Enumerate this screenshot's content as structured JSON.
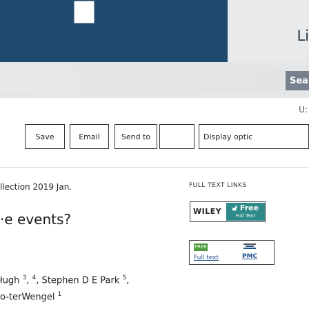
{
  "header": {
    "corner_text": "Li",
    "search_button_label": "Sea",
    "user_hint": "U:"
  },
  "toolbar": {
    "buttons": [
      "Save",
      "Email",
      "Send to",
      "Display optic"
    ]
  },
  "article": {
    "collection": "llection 2019 Jan.",
    "title": "·e events?",
    "authors_line1_prefix": "ługh ",
    "authors_line1_sup1": "3",
    "authors_line1_sep": ", ",
    "authors_line1_sup2": "4",
    "authors_line1_mid": ", Stephen D E Park ",
    "authors_line1_sup3": "5",
    "authors_line1_end": ",",
    "authors_line2_text": "o-terWengel ",
    "authors_line2_sup": "1"
  },
  "links": {
    "heading": "FULL TEXT LINKS",
    "wiley_label": "WILEY",
    "wiley_free_top": "Free",
    "wiley_free_bottom": "Full Text",
    "free_tag": "FREE",
    "pmc_fulltext": "Full text",
    "pmc_label": "PMC"
  }
}
